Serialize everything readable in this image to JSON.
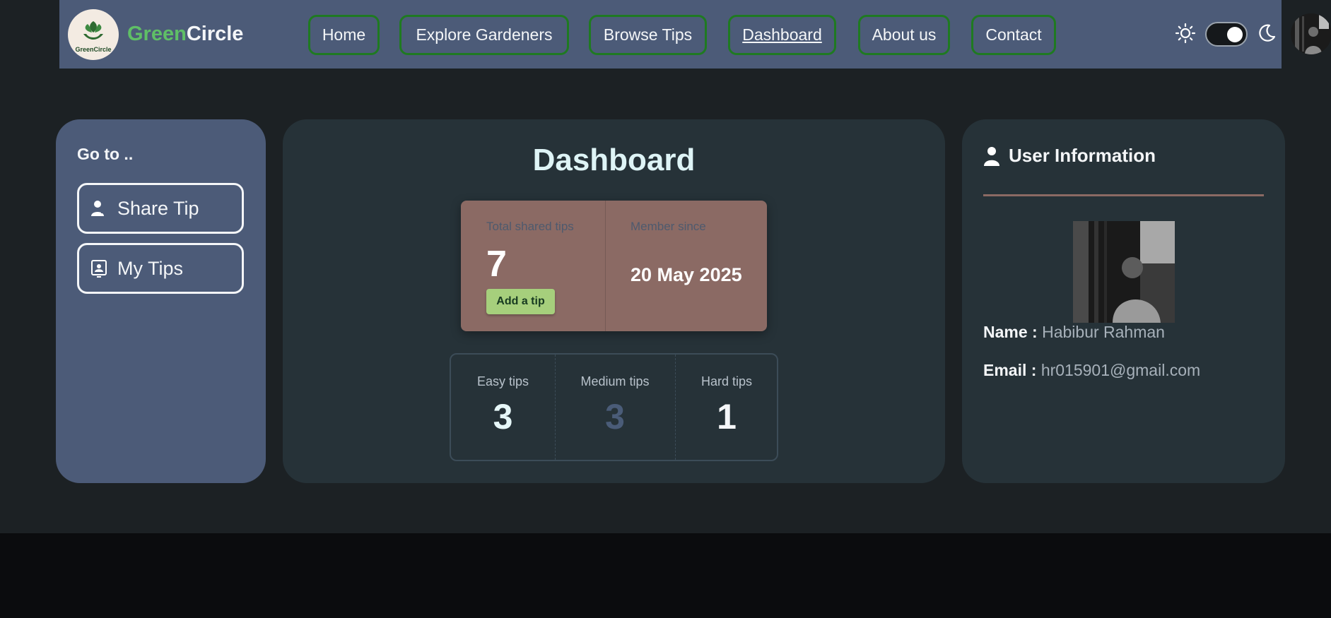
{
  "brand": {
    "logo_text": "GreenCircle",
    "name_part1": "Green",
    "name_part2": "Circle"
  },
  "nav": {
    "items": [
      {
        "label": "Home",
        "active": false
      },
      {
        "label": "Explore Gardeners",
        "active": false
      },
      {
        "label": "Browse Tips",
        "active": false
      },
      {
        "label": "Dashboard",
        "active": true
      },
      {
        "label": "About us",
        "active": false
      },
      {
        "label": "Contact",
        "active": false
      }
    ],
    "theme_toggle": {
      "state": "dark",
      "left_icon": "sun-icon",
      "right_icon": "moon-icon"
    }
  },
  "sidebar": {
    "title": "Go to ..",
    "items": [
      {
        "label": "Share Tip",
        "icon": "user-share-icon"
      },
      {
        "label": "My Tips",
        "icon": "id-card-icon"
      }
    ]
  },
  "dashboard": {
    "title": "Dashboard",
    "total_label": "Total shared tips",
    "total_value": "7",
    "add_tip_label": "Add a tip",
    "member_label": "Member since",
    "member_value": "20 May 2025",
    "difficulty": [
      {
        "label": "Easy tips",
        "value": "3",
        "color": "#e6f7f8"
      },
      {
        "label": "Medium tips",
        "value": "3",
        "color": "#4a5c78"
      },
      {
        "label": "Hard tips",
        "value": "1",
        "color": "#f4f6f8"
      }
    ]
  },
  "user_info": {
    "title": "User Information",
    "name_label": "Name :",
    "name_value": "Habibur Rahman",
    "email_label": "Email :",
    "email_value": "hr015901@gmail.com"
  },
  "colors": {
    "nav_bg": "#4c5b78",
    "page_bg": "#1c2124",
    "card_bg": "#263238",
    "accent_green": "#5fbf66",
    "nav_border": "#1f7a21",
    "stats_bg": "#8b6a64",
    "add_tip_bg": "#a6cf7c"
  }
}
